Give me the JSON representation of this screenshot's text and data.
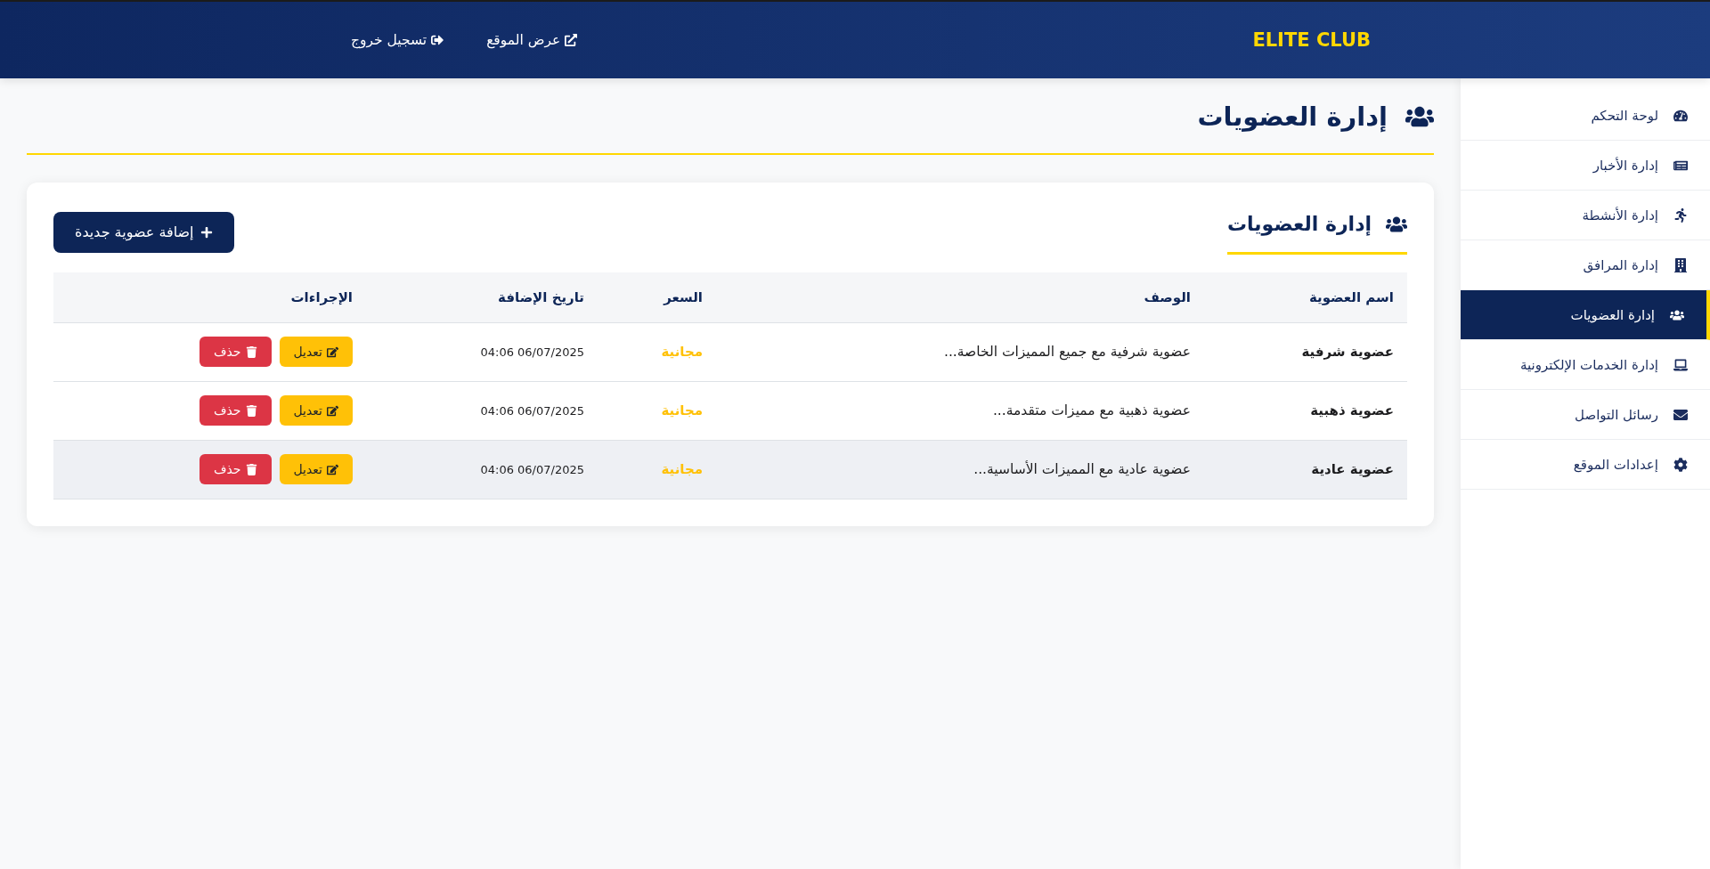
{
  "header": {
    "brand": "ELITE CLUB",
    "links": [
      {
        "label": "عرض الموقع"
      },
      {
        "label": "تسجيل خروج"
      }
    ]
  },
  "sidebar": {
    "items": [
      {
        "label": "لوحة التحكم",
        "selected": false
      },
      {
        "label": "إدارة الأخبار",
        "selected": false
      },
      {
        "label": "إدارة الأنشطة",
        "selected": false
      },
      {
        "label": "إدارة المرافق",
        "selected": false
      },
      {
        "label": "إدارة العضويات",
        "selected": true
      },
      {
        "label": "إدارة الخدمات الإلكترونية",
        "selected": false
      },
      {
        "label": "رسائل التواصل",
        "selected": false
      },
      {
        "label": "إعدادات الموقع",
        "selected": false
      }
    ]
  },
  "page": {
    "title": "إدارة العضويات"
  },
  "card": {
    "title": "إدارة العضويات",
    "add_button": "إضافة عضوية جديدة"
  },
  "table": {
    "columns": [
      "اسم العضوية",
      "الوصف",
      "السعر",
      "تاريخ الإضافة",
      "الإجراءات"
    ],
    "rows": [
      {
        "name": "عضوية شرفية",
        "description": "عضوية شرفية مع جميع المميزات الخاصة...",
        "price": "مجانية",
        "date": "04:06 06/07/2025",
        "highlighted": false,
        "actions": [
          {
            "kind": "edit",
            "label": "تعديل"
          },
          {
            "kind": "delete",
            "label": "حذف"
          }
        ]
      },
      {
        "name": "عضوية ذهبية",
        "description": "عضوية ذهبية مع مميزات متقدمة...",
        "price": "مجانية",
        "date": "04:06 06/07/2025",
        "highlighted": false,
        "actions": [
          {
            "kind": "edit",
            "label": "تعديل"
          },
          {
            "kind": "delete",
            "label": "حذف"
          }
        ]
      },
      {
        "name": "عضوية عادية",
        "description": "عضوية عادية مع المميزات الأساسية...",
        "price": "مجانية",
        "date": "04:06 06/07/2025",
        "highlighted": true,
        "actions": [
          {
            "kind": "edit",
            "label": "تعديل"
          },
          {
            "kind": "delete",
            "label": "حذف"
          }
        ]
      }
    ]
  }
}
